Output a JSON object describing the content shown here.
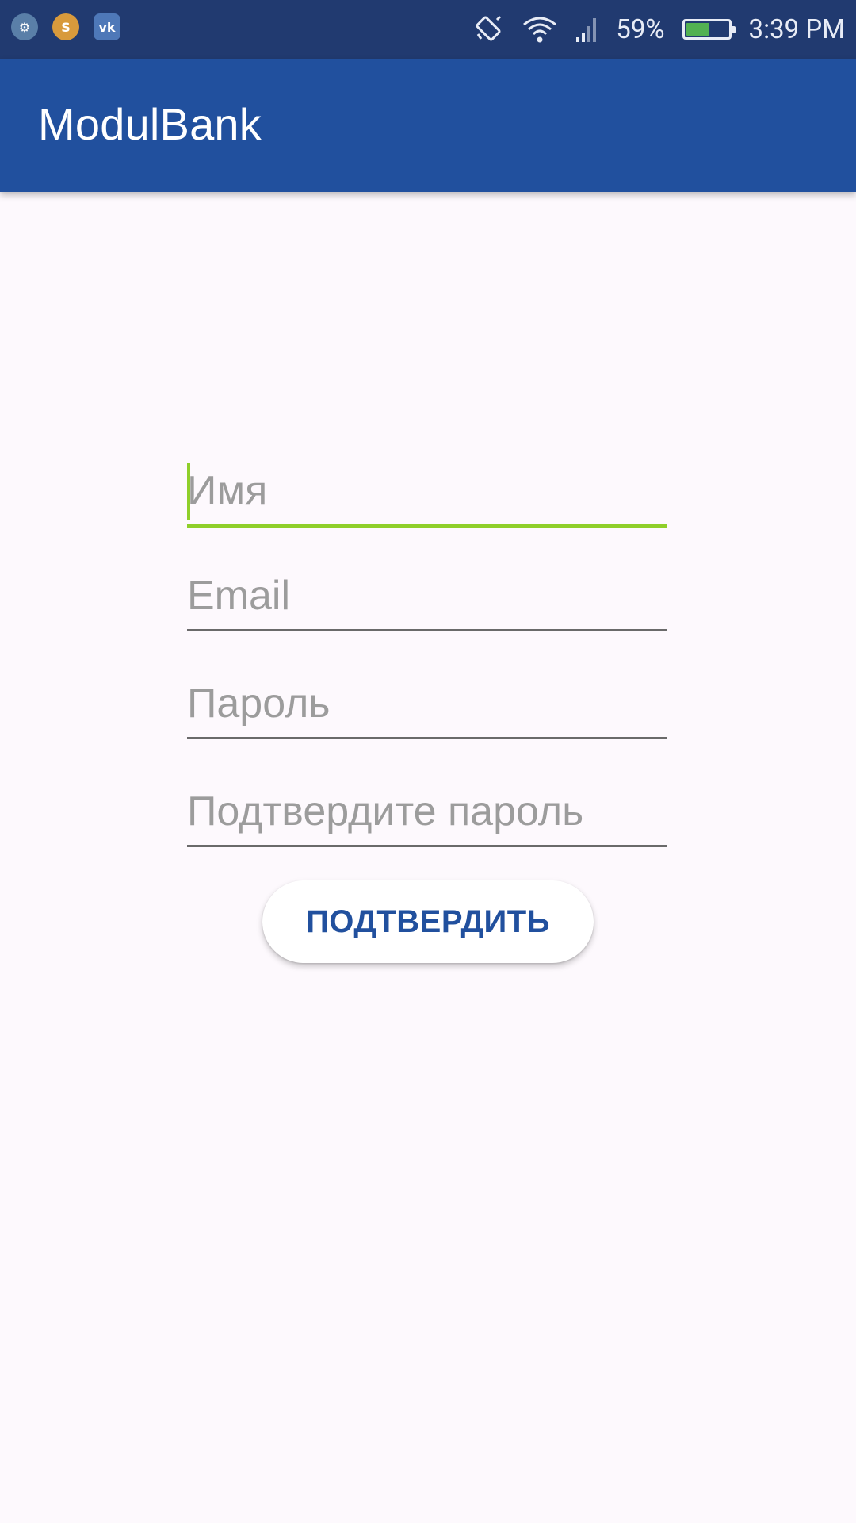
{
  "status_bar": {
    "notifications": [
      {
        "icon": "android-icon",
        "glyph": "⚙"
      },
      {
        "icon": "slides-app-icon",
        "glyph": "S"
      },
      {
        "icon": "vk-icon",
        "glyph": "vk"
      }
    ],
    "battery_percent_label": "59%",
    "battery_level": 0.59,
    "time": "3:39 PM"
  },
  "app_bar": {
    "title": "ModulBank"
  },
  "form": {
    "name_placeholder": "Имя",
    "email_placeholder": "Email",
    "password_placeholder": "Пароль",
    "confirm_password_placeholder": "Подтвердите пароль",
    "submit_label": "ПОДТВЕРДИТЬ"
  },
  "colors": {
    "status_bar": "#213a70",
    "app_bar": "#21509e",
    "accent": "#8fcf2a",
    "background": "#fdf9fd",
    "button_text": "#21509e"
  }
}
